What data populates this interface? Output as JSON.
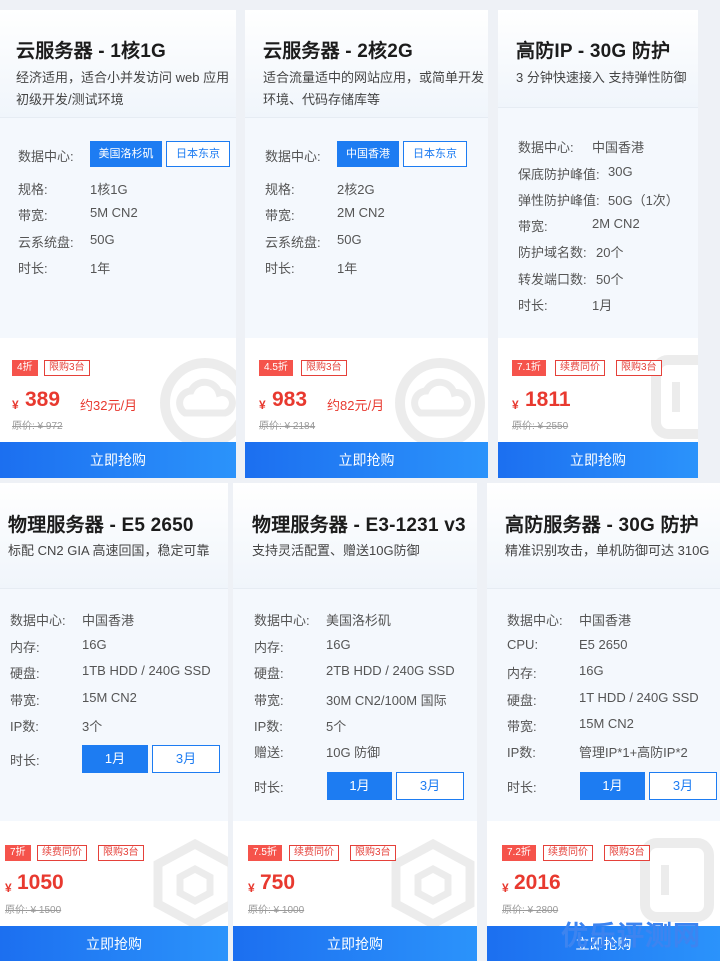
{
  "common": {
    "buy_label": "立即抢购",
    "currency": "¥",
    "duration_label": "时长:"
  },
  "cards": [
    {
      "title": "云服务器 - 1核1G",
      "desc": "经济适用，适合小并发访问 web 应用\n初级开发/测试环境",
      "dc_label": "数据中心:",
      "dc_options": [
        "美国洛杉矶",
        "日本东京"
      ],
      "specs": [
        {
          "label": "规格:",
          "value": "1核1G"
        },
        {
          "label": "带宽:",
          "value": "5M CN2"
        },
        {
          "label": "云系统盘:",
          "value": "50G"
        },
        {
          "label": "时长:",
          "value": "1年"
        }
      ],
      "tags": [
        "4折",
        "限购3台"
      ],
      "price": "389",
      "monthly": "约32元/月",
      "original": "原价: ¥ 972"
    },
    {
      "title": "云服务器 - 2核2G",
      "desc": "适合流量适中的网站应用，或简单开发\n环境、代码存储库等",
      "dc_label": "数据中心:",
      "dc_options": [
        "中国香港",
        "日本东京"
      ],
      "specs": [
        {
          "label": "规格:",
          "value": "2核2G"
        },
        {
          "label": "带宽:",
          "value": "2M CN2"
        },
        {
          "label": "云系统盘:",
          "value": "50G"
        },
        {
          "label": "时长:",
          "value": "1年"
        }
      ],
      "tags": [
        "4.5折",
        "限购3台"
      ],
      "price": "983",
      "monthly": "约82元/月",
      "original": "原价: ¥ 2184"
    },
    {
      "title": "高防IP - 30G 防护",
      "desc": "3 分钟快速接入 支持弹性防御",
      "specs": [
        {
          "label": "数据中心:",
          "value": "中国香港"
        },
        {
          "label": "保底防护峰值:",
          "value": "30G"
        },
        {
          "label": "弹性防护峰值:",
          "value": "50G（1次）"
        },
        {
          "label": "带宽:",
          "value": "2M CN2"
        },
        {
          "label": "防护域名数:",
          "value": "20个"
        },
        {
          "label": "转发端口数:",
          "value": "50个"
        },
        {
          "label": "时长:",
          "value": "1月"
        }
      ],
      "tags": [
        "7.1折",
        "续费同价",
        "限购3台"
      ],
      "price": "1811",
      "original": "原价: ¥ 2550"
    },
    {
      "title": "物理服务器 - E5 2650",
      "desc": "标配 CN2 GIA 高速回国，稳定可靠",
      "specs": [
        {
          "label": "数据中心:",
          "value": "中国香港"
        },
        {
          "label": "内存:",
          "value": "16G"
        },
        {
          "label": "硬盘:",
          "value": "1TB HDD / 240G SSD"
        },
        {
          "label": "带宽:",
          "value": "15M CN2"
        },
        {
          "label": "IP数:",
          "value": "3个"
        }
      ],
      "durations": [
        "1月",
        "3月"
      ],
      "tags": [
        "7折",
        "续费同价",
        "限购3台"
      ],
      "price": "1050",
      "original": "原价: ¥ 1500"
    },
    {
      "title": "物理服务器 - E3-1231 v3",
      "desc": "支持灵活配置、赠送10G防御",
      "specs": [
        {
          "label": "数据中心:",
          "value": "美国洛杉矶"
        },
        {
          "label": "内存:",
          "value": "16G"
        },
        {
          "label": "硬盘:",
          "value": "2TB HDD / 240G SSD"
        },
        {
          "label": "带宽:",
          "value": "30M CN2/100M 国际"
        },
        {
          "label": "IP数:",
          "value": "5个"
        },
        {
          "label": "赠送:",
          "value": "10G 防御"
        }
      ],
      "durations": [
        "1月",
        "3月"
      ],
      "tags": [
        "7.5折",
        "续费同价",
        "限购3台"
      ],
      "price": "750",
      "original": "原价: ¥ 1000"
    },
    {
      "title": "高防服务器 - 30G 防护",
      "desc": "精准识别攻击，单机防御可达 310G",
      "specs": [
        {
          "label": "数据中心:",
          "value": "中国香港"
        },
        {
          "label": "CPU:",
          "value": "E5 2650"
        },
        {
          "label": "内存:",
          "value": "16G"
        },
        {
          "label": "硬盘:",
          "value": "1T HDD / 240G SSD"
        },
        {
          "label": "带宽:",
          "value": "15M CN2"
        },
        {
          "label": "IP数:",
          "value": "管理IP*1+高防IP*2"
        }
      ],
      "durations": [
        "1月",
        "3月"
      ],
      "tags": [
        "7.2折",
        "续费同价",
        "限购3台"
      ],
      "price": "2016",
      "original": "原价: ¥ 2800"
    }
  ],
  "watermark": "优乐评测网"
}
